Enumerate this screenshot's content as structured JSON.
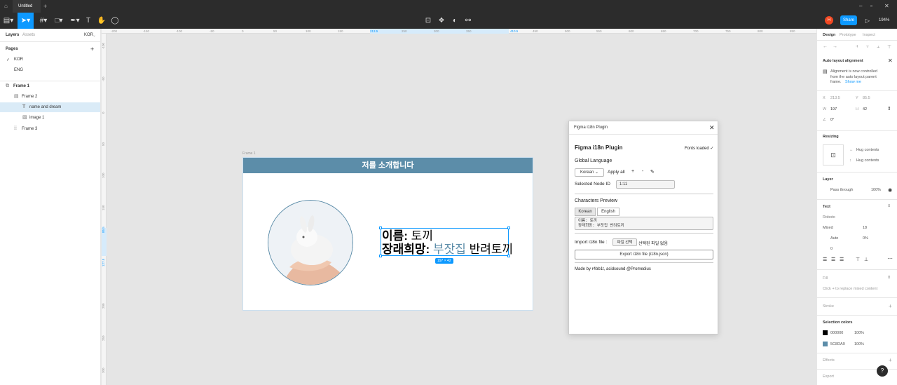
{
  "titlebar": {
    "tab": "Untitled"
  },
  "toolbar": {
    "share": "Share",
    "zoom": "194%",
    "avatar": "H"
  },
  "left": {
    "tabs": [
      "Layers",
      "Assets"
    ],
    "page_selector": "KOR",
    "pages_title": "Pages",
    "pages": [
      "KOR",
      "ENG"
    ],
    "layers": [
      "Frame 1",
      "Frame 2",
      "name and dream",
      "image 1",
      "Frame 3"
    ]
  },
  "ruler": {
    "top": [
      "-200",
      "-150",
      "-100",
      "-50",
      "0",
      "50",
      "100",
      "150",
      "213.5",
      "250",
      "300",
      "350",
      "410.5",
      "450",
      "500",
      "550",
      "600",
      "650",
      "700",
      "750",
      "800",
      "850"
    ],
    "left": [
      "-100",
      "-50",
      "0",
      "50",
      "100",
      "150",
      "85.5",
      "127.5",
      "200",
      "250",
      "300",
      "350"
    ]
  },
  "canvas": {
    "frame_label": "Frame 1",
    "header": "저를 소개합니다",
    "line1_bold": "이름:",
    "line1_rest": " 토끼",
    "line2_bold": "장래희망:",
    "line2_accent": " 부잣집",
    "line2_rest": " 반려토끼",
    "dimension": "197 × 42"
  },
  "plugin": {
    "window_title": "Figma i18n Plugin",
    "heading": "Figma i18n Plugin",
    "fonts_loaded": "Fonts loaded ✓",
    "global_language": "Global Language",
    "language_select": "Korean",
    "apply_all": "Apply all",
    "selected_node_label": "Selected Node ID",
    "selected_node_value": "1:11",
    "characters_preview": "Characters Preview",
    "tab_korean": "Korean",
    "tab_english": "English",
    "preview_line1": "이름: 토끼",
    "preview_line2": "장래희망: 부잣집 반려토끼",
    "import_label": "Import i18n file :",
    "file_button": "파일 선택",
    "no_file": "선택된 파일 없음",
    "export_button": "Export i18n file (i18n.json)",
    "credits": "Made by r4bb1t, acidsound @Promedius"
  },
  "right": {
    "tabs": [
      "Design",
      "Prototype",
      "Inspect"
    ],
    "auto_layout_title": "Auto layout alignment",
    "auto_layout_text1": "Alignment is now controlled",
    "auto_layout_text2": "from the auto layout parent",
    "auto_layout_text3": "frame.",
    "show_me": "Show me",
    "x": "213.5",
    "y": "85.5",
    "w": "197",
    "h": "42",
    "rotation": "0°",
    "resizing": "Resizing",
    "hug1": "Hug contents",
    "hug2": "Hug contents",
    "layer": "Layer",
    "pass_through": "Pass through",
    "layer_opacity": "100%",
    "text": "Text",
    "font": "Roboto",
    "weight": "Mixed",
    "size": "18",
    "line_height": "Auto",
    "letter_spacing": "0%",
    "para_spacing": "0",
    "fill": "Fill",
    "fill_hint": "Click + to replace mixed content",
    "stroke": "Stroke",
    "selection_colors": "Selection colors",
    "colors": [
      {
        "hex": "000000",
        "opacity": "100%",
        "swatch": "#000000"
      },
      {
        "hex": "5C8DA9",
        "opacity": "100%",
        "swatch": "#5C8DA9"
      }
    ],
    "effects": "Effects",
    "export": "Export"
  },
  "colors": {
    "accent": "#0d99ff",
    "frame_header": "#5C8DA9",
    "toolbar": "#2c2c2c"
  }
}
